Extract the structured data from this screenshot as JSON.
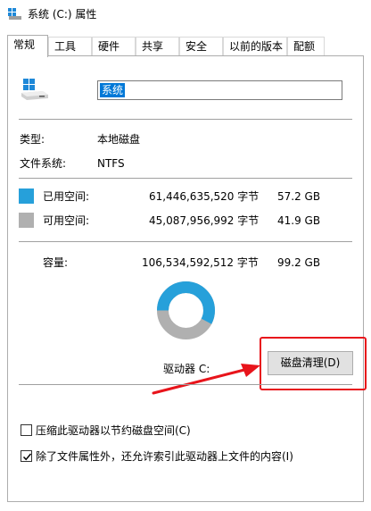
{
  "window": {
    "title": "系统 (C:) 属性",
    "icon": "drive-icon"
  },
  "tabs": [
    {
      "label": "常规",
      "active": true
    },
    {
      "label": "工具",
      "active": false
    },
    {
      "label": "硬件",
      "active": false
    },
    {
      "label": "共享",
      "active": false
    },
    {
      "label": "安全",
      "active": false
    },
    {
      "label": "以前的版本",
      "active": false
    },
    {
      "label": "配额",
      "active": false
    }
  ],
  "general": {
    "drive_name": "系统",
    "type_label": "类型:",
    "type_value": "本地磁盘",
    "fs_label": "文件系统:",
    "fs_value": "NTFS",
    "used": {
      "label": "已用空间:",
      "bytes": "61,446,635,520 字节",
      "size": "57.2 GB",
      "color": "#26a0da"
    },
    "free": {
      "label": "可用空间:",
      "bytes": "45,087,956,992 字节",
      "size": "41.9 GB",
      "color": "#b0b0b0"
    },
    "capacity": {
      "label": "容量:",
      "bytes": "106,534,592,512 字节",
      "size": "99.2 GB"
    },
    "drive_label": "驱动器 C:",
    "cleanup_button": "磁盘清理(D)",
    "compress_label": "压缩此驱动器以节约磁盘空间(C)",
    "compress_checked": false,
    "index_label": "除了文件属性外，还允许索引此驱动器上文件的内容(I)",
    "index_checked": true
  },
  "usage_fraction": 0.577,
  "accent_color": "#e8141b"
}
